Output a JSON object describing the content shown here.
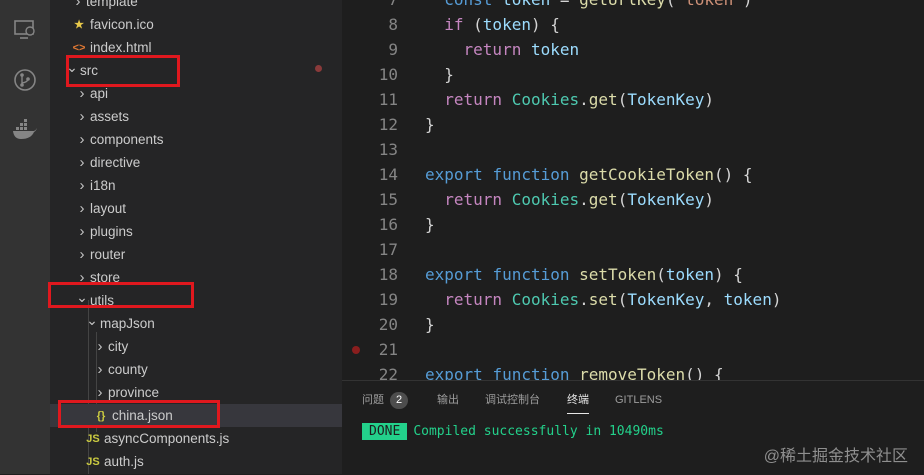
{
  "activity_bar": {
    "icons": [
      "remote-explorer-icon",
      "source-control-icon",
      "docker-icon"
    ]
  },
  "explorer": {
    "rows": [
      {
        "label": "template",
        "kind": "folder",
        "expanded": false
      },
      {
        "label": "favicon.ico",
        "kind": "file",
        "icon": "★",
        "icon_color": "#e8c94a"
      },
      {
        "label": "index.html",
        "kind": "file",
        "icon": "<>",
        "icon_color": "#e37933"
      },
      {
        "label": "src",
        "kind": "folder",
        "expanded": true
      },
      {
        "label": "api",
        "kind": "folder",
        "expanded": false
      },
      {
        "label": "assets",
        "kind": "folder",
        "expanded": false
      },
      {
        "label": "components",
        "kind": "folder",
        "expanded": false
      },
      {
        "label": "directive",
        "kind": "folder",
        "expanded": false
      },
      {
        "label": "i18n",
        "kind": "folder",
        "expanded": false
      },
      {
        "label": "layout",
        "kind": "folder",
        "expanded": false
      },
      {
        "label": "plugins",
        "kind": "folder",
        "expanded": false
      },
      {
        "label": "router",
        "kind": "folder",
        "expanded": false
      },
      {
        "label": "store",
        "kind": "folder",
        "expanded": false
      },
      {
        "label": "utils",
        "kind": "folder",
        "expanded": true
      },
      {
        "label": "mapJson",
        "kind": "folder",
        "expanded": true
      },
      {
        "label": "city",
        "kind": "folder",
        "expanded": false
      },
      {
        "label": "county",
        "kind": "folder",
        "expanded": false
      },
      {
        "label": "province",
        "kind": "folder",
        "expanded": false
      },
      {
        "label": "china.json",
        "kind": "file",
        "icon": "{}",
        "icon_color": "#cbcb41"
      },
      {
        "label": "asyncComponents.js",
        "kind": "file",
        "icon": "JS",
        "icon_color": "#cbcb41"
      },
      {
        "label": "auth.js",
        "kind": "file",
        "icon": "JS",
        "icon_color": "#cbcb41"
      }
    ]
  },
  "editor": {
    "lines": [
      {
        "n": "7",
        "t": [
          [
            "  ",
            "pl"
          ],
          [
            "const ",
            "kw"
          ],
          [
            "token",
            "var"
          ],
          [
            " = ",
            "pl"
          ],
          [
            "getUrlKey",
            "fn"
          ],
          [
            "(",
            "pl"
          ],
          [
            "'token'",
            "str"
          ],
          [
            ")",
            "pl"
          ]
        ]
      },
      {
        "n": "8",
        "t": [
          [
            "  ",
            "pl"
          ],
          [
            "if",
            "kw2"
          ],
          [
            " (",
            "pl"
          ],
          [
            "token",
            "var"
          ],
          [
            ") {",
            "pl"
          ]
        ]
      },
      {
        "n": "9",
        "t": [
          [
            "    ",
            "pl"
          ],
          [
            "return",
            "kw2"
          ],
          [
            " ",
            "pl"
          ],
          [
            "token",
            "var"
          ]
        ]
      },
      {
        "n": "10",
        "t": [
          [
            "  }",
            "pl"
          ]
        ]
      },
      {
        "n": "11",
        "t": [
          [
            "  ",
            "pl"
          ],
          [
            "return",
            "kw2"
          ],
          [
            " ",
            "pl"
          ],
          [
            "Cookies",
            "cls"
          ],
          [
            ".",
            "pl"
          ],
          [
            "get",
            "fn"
          ],
          [
            "(",
            "pl"
          ],
          [
            "TokenKey",
            "var"
          ],
          [
            ")",
            "pl"
          ]
        ]
      },
      {
        "n": "12",
        "t": [
          [
            "}",
            "pl"
          ]
        ]
      },
      {
        "n": "13",
        "t": []
      },
      {
        "n": "14",
        "t": [
          [
            "export",
            "kw"
          ],
          [
            " ",
            "pl"
          ],
          [
            "function",
            "kw"
          ],
          [
            " ",
            "pl"
          ],
          [
            "getCookieToken",
            "fn"
          ],
          [
            "() {",
            "pl"
          ]
        ]
      },
      {
        "n": "15",
        "t": [
          [
            "  ",
            "pl"
          ],
          [
            "return",
            "kw2"
          ],
          [
            " ",
            "pl"
          ],
          [
            "Cookies",
            "cls"
          ],
          [
            ".",
            "pl"
          ],
          [
            "get",
            "fn"
          ],
          [
            "(",
            "pl"
          ],
          [
            "TokenKey",
            "var"
          ],
          [
            ")",
            "pl"
          ]
        ]
      },
      {
        "n": "16",
        "t": [
          [
            "}",
            "pl"
          ]
        ]
      },
      {
        "n": "17",
        "t": []
      },
      {
        "n": "18",
        "t": [
          [
            "export",
            "kw"
          ],
          [
            " ",
            "pl"
          ],
          [
            "function",
            "kw"
          ],
          [
            " ",
            "pl"
          ],
          [
            "setToken",
            "fn"
          ],
          [
            "(",
            "pl"
          ],
          [
            "token",
            "var"
          ],
          [
            ") {",
            "pl"
          ]
        ]
      },
      {
        "n": "19",
        "t": [
          [
            "  ",
            "pl"
          ],
          [
            "return",
            "kw2"
          ],
          [
            " ",
            "pl"
          ],
          [
            "Cookies",
            "cls"
          ],
          [
            ".",
            "pl"
          ],
          [
            "set",
            "fn"
          ],
          [
            "(",
            "pl"
          ],
          [
            "TokenKey",
            "var"
          ],
          [
            ", ",
            "pl"
          ],
          [
            "token",
            "var"
          ],
          [
            ")",
            "pl"
          ]
        ]
      },
      {
        "n": "20",
        "t": [
          [
            "}",
            "pl"
          ]
        ]
      },
      {
        "n": "21",
        "t": []
      },
      {
        "n": "22",
        "t": [
          [
            "export",
            "kw"
          ],
          [
            " ",
            "pl"
          ],
          [
            "function",
            "kw"
          ],
          [
            " ",
            "pl"
          ],
          [
            "removeToken",
            "fn"
          ],
          [
            "() {",
            "pl"
          ]
        ]
      }
    ]
  },
  "panel": {
    "tabs": [
      {
        "label": "问题",
        "badge": "2"
      },
      {
        "label": "输出"
      },
      {
        "label": "调试控制台"
      },
      {
        "label": "终端",
        "active": true
      },
      {
        "label": "GITLENS"
      }
    ],
    "terminal": {
      "status": "DONE",
      "message": "Compiled successfully in 10490ms"
    }
  },
  "watermark": "@稀土掘金技术社区",
  "colors": {
    "annotation_red": "#e0181e",
    "done_green": "#23d18b"
  }
}
